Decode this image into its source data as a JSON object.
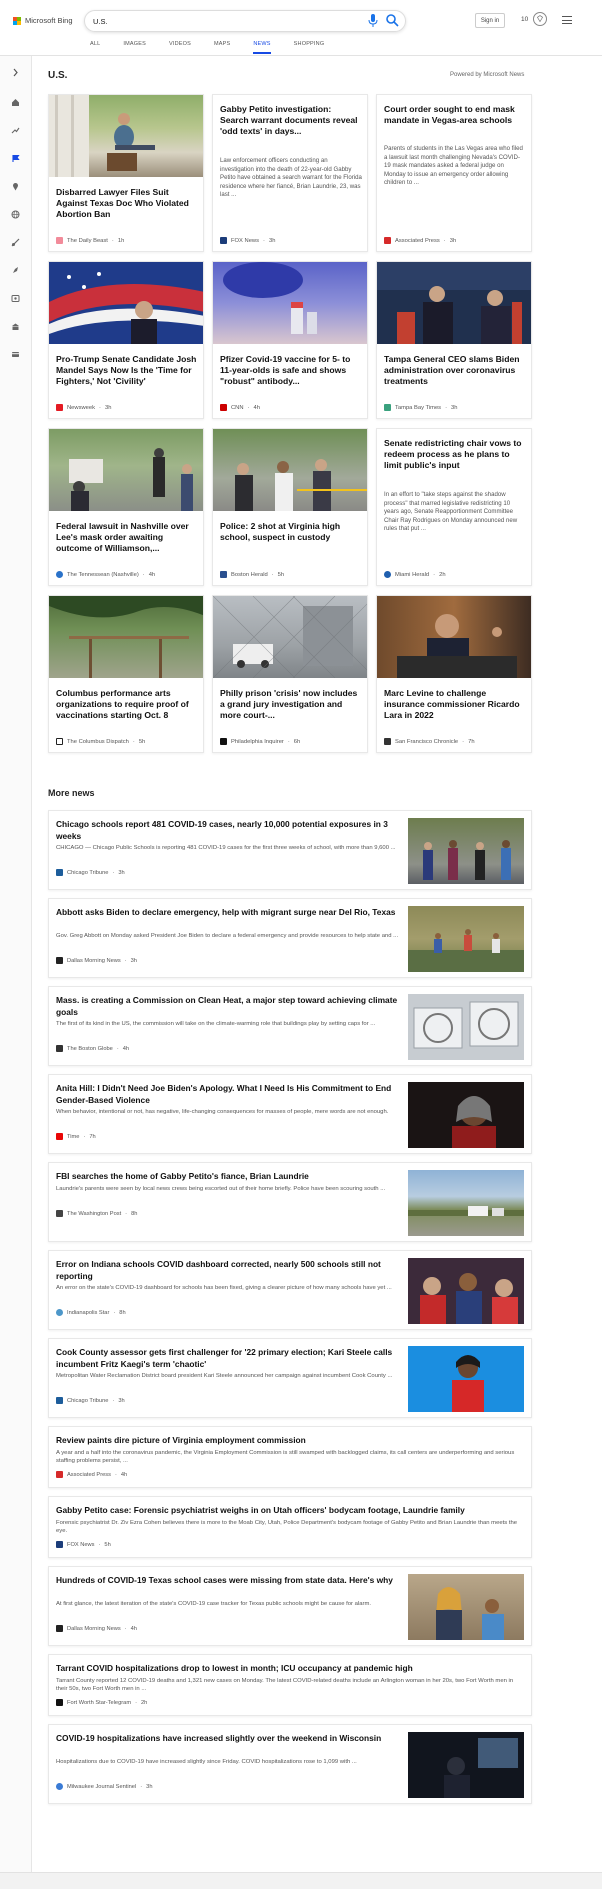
{
  "header": {
    "brand": "Microsoft Bing",
    "search_value": "U.S.",
    "signin_label": "Sign in",
    "points": "10",
    "scopes": [
      "ALL",
      "IMAGES",
      "VIDEOS",
      "MAPS",
      "NEWS",
      "SHOPPING"
    ],
    "active_scope": "NEWS"
  },
  "section": {
    "title": "U.S.",
    "powered": "Powered by Microsoft News"
  },
  "cards": [
    {
      "title": "Disbarred Lawyer Files Suit Against Texas Doc Who Violated Abortion Ban",
      "snippet": "",
      "source": "The Daily Beast",
      "time": "1h",
      "src_color": "#f28b9a"
    },
    {
      "title": "Gabby Petito investigation: Search warrant documents reveal 'odd texts' in days...",
      "snippet": "Law enforcement officers conducting an investigation into the death of 22-year-old Gabby Petito have obtained a search warrant for the Florida residence where her fiancé, Brian Laundrie, 23, was last ...",
      "source": "FOX News",
      "time": "3h",
      "src_color": "#1c3d7a"
    },
    {
      "title": "Court order sought to end mask mandate in Vegas-area schools",
      "snippet": "Parents of students in the Las Vegas area who filed a lawsuit last month challenging Nevada's COVID-19 mask mandates asked a federal judge on Monday to issue an emergency order allowing children to ...",
      "source": "Associated Press",
      "time": "3h",
      "src_color": "#d62a2a"
    },
    {
      "title": "Pro-Trump Senate Candidate Josh Mandel Says Now Is the 'Time for Fighters,' Not 'Civility'",
      "snippet": "",
      "source": "Newsweek",
      "time": "3h",
      "src_color": "#e41b23"
    },
    {
      "title": "Pfizer Covid-19 vaccine for 5- to 11-year-olds is safe and shows \"robust\" antibody...",
      "snippet": "",
      "source": "CNN",
      "time": "4h",
      "src_color": "#cc0000"
    },
    {
      "title": "Tampa General CEO slams Biden administration over coronavirus treatments",
      "snippet": "",
      "source": "Tampa Bay Times",
      "time": "3h",
      "src_color": "#3aa17e"
    },
    {
      "title": "Federal lawsuit in Nashville over Lee's mask order awaiting outcome of Williamson,...",
      "snippet": "",
      "source": "The Tennessean (Nashville)",
      "time": "4h",
      "src_color": "#2a72c9"
    },
    {
      "title": "Police: 2 shot at Virginia high school, suspect in custody",
      "snippet": "",
      "source": "Boston Herald",
      "time": "5h",
      "src_color": "#2a4f8f"
    },
    {
      "title": "Senate redistricting chair vows to redeem process as he plans to limit public's input",
      "snippet": "In an effort to \"take steps against the shadow process\" that marred legislative redistricting 10 years ago, Senate Reapportionment Committee Chair Ray Rodrigues on Monday announced new rules that put ...",
      "source": "Miami Herald",
      "time": "2h",
      "src_color": "#1f5fae"
    },
    {
      "title": "Columbus performance arts organizations to require proof of vaccinations starting Oct. 8",
      "snippet": "",
      "source": "The Columbus Dispatch",
      "time": "5h",
      "src_color": "#222222"
    },
    {
      "title": "Philly prison 'crisis' now includes a grand jury investigation and more court-...",
      "snippet": "",
      "source": "Philadelphia Inquirer",
      "time": "6h",
      "src_color": "#111111"
    },
    {
      "title": "Marc Levine to challenge insurance commissioner Ricardo Lara in 2022",
      "snippet": "",
      "source": "San Francisco Chronicle",
      "time": "7h",
      "src_color": "#333333"
    }
  ],
  "more": {
    "title": "More news",
    "items": [
      {
        "title": "Chicago schools report 481 COVID-19 cases, nearly 10,000 potential exposures in 3 weeks",
        "snippet": "CHICAGO — Chicago Public Schools is reporting 481 COVID-19 cases for the first three weeks of school, with more than 9,600 ...",
        "source": "Chicago Tribune",
        "time": "3h",
        "src_color": "#1d5d9b"
      },
      {
        "title": "Abbott asks Biden to declare emergency, help with migrant surge near Del Rio, Texas",
        "snippet": "Gov. Greg Abbott on Monday asked President Joe Biden to declare a federal emergency and provide resources to help state and ...",
        "source": "Dallas Morning News",
        "time": "3h",
        "src_color": "#222222"
      },
      {
        "title": "Mass. is creating a Commission on Clean Heat, a major step toward achieving climate goals",
        "snippet": "The first of its kind in the US, the commission will take on the climate-warming role that buildings play by setting caps for ...",
        "source": "The Boston Globe",
        "time": "4h",
        "src_color": "#333333"
      },
      {
        "title": "Anita Hill: I Didn't Need Joe Biden's Apology. What I Need Is His Commitment to End Gender-Based Violence",
        "snippet": "When behavior, intentional or not, has negative, life-changing consequences for masses of people, mere words are not enough.",
        "source": "Time",
        "time": "7h",
        "src_color": "#e90606"
      },
      {
        "title": "FBI searches the home of Gabby Petito's fiance, Brian Laundrie",
        "snippet": "Laundrie's parents were seen by local news crews being escorted out of their home briefly. Police have been scouring south ...",
        "source": "The Washington Post",
        "time": "8h",
        "src_color": "#444444"
      },
      {
        "title": "Error on Indiana schools COVID dashboard corrected, nearly 500 schools still not reporting",
        "snippet": "An error on the state's COVID-19 dashboard for schools has been fixed, giving a clearer picture of how many schools have yet ...",
        "source": "Indianapolis Star",
        "time": "8h",
        "src_color": "#4d97c9"
      },
      {
        "title": "Cook County assessor gets first challenger for '22 primary election; Kari Steele calls incumbent Fritz Kaegi's term 'chaotic'",
        "snippet": "Metropolitan Water Reclamation District board president Kari Steele announced her campaign against incumbent Cook County ...",
        "source": "Chicago Tribune",
        "time": "3h",
        "src_color": "#1d5d9b"
      },
      {
        "title": "Review paints dire picture of Virginia employment commission",
        "snippet": "A year and a half into the coronavirus pandemic, the Virginia Employment Commission is still swamped with backlogged claims, its call centers are underperforming and serious staffing problems persist, ...",
        "source": "Associated Press",
        "time": "4h",
        "src_color": "#d62a2a"
      },
      {
        "title": "Gabby Petito case: Forensic psychiatrist weighs in on Utah officers' bodycam footage, Laundrie family",
        "snippet": "Forensic psychiatrist Dr. Ziv Ezra Cohen believes there is more to the Moab City, Utah, Police Department's bodycam footage of Gabby Petito and Brian Laundrie than meets the eye.",
        "source": "FOX News",
        "time": "5h",
        "src_color": "#1c3d7a"
      },
      {
        "title": "Hundreds of COVID-19 Texas school cases were missing from state data. Here's why",
        "snippet": "At first glance, the latest iteration of the state's COVID-19 case tracker for Texas public schools might be cause for alarm.",
        "source": "Dallas Morning News",
        "time": "4h",
        "src_color": "#222222"
      },
      {
        "title": "Tarrant COVID hospitalizations drop to lowest in month; ICU occupancy at pandemic high",
        "snippet": "Tarrant County reported 12 COVID-19 deaths and 1,321 new cases on Monday. The latest COVID-related deaths include an Arlington woman in her 20s, two Fort Worth men in their 50s, two Fort Worth men in ...",
        "source": "Fort Worth Star-Telegram",
        "time": "2h",
        "src_color": "#111111"
      },
      {
        "title": "COVID-19 hospitalizations have increased slightly over the weekend in Wisconsin",
        "snippet": "Hospitalizations due to COVID-19 have increased slightly since Friday.  COVID hospitalizations rose to 1,099 with ...",
        "source": "Milwaukee Journal Sentinel",
        "time": "3h",
        "src_color": "#3a7bd5"
      }
    ]
  }
}
